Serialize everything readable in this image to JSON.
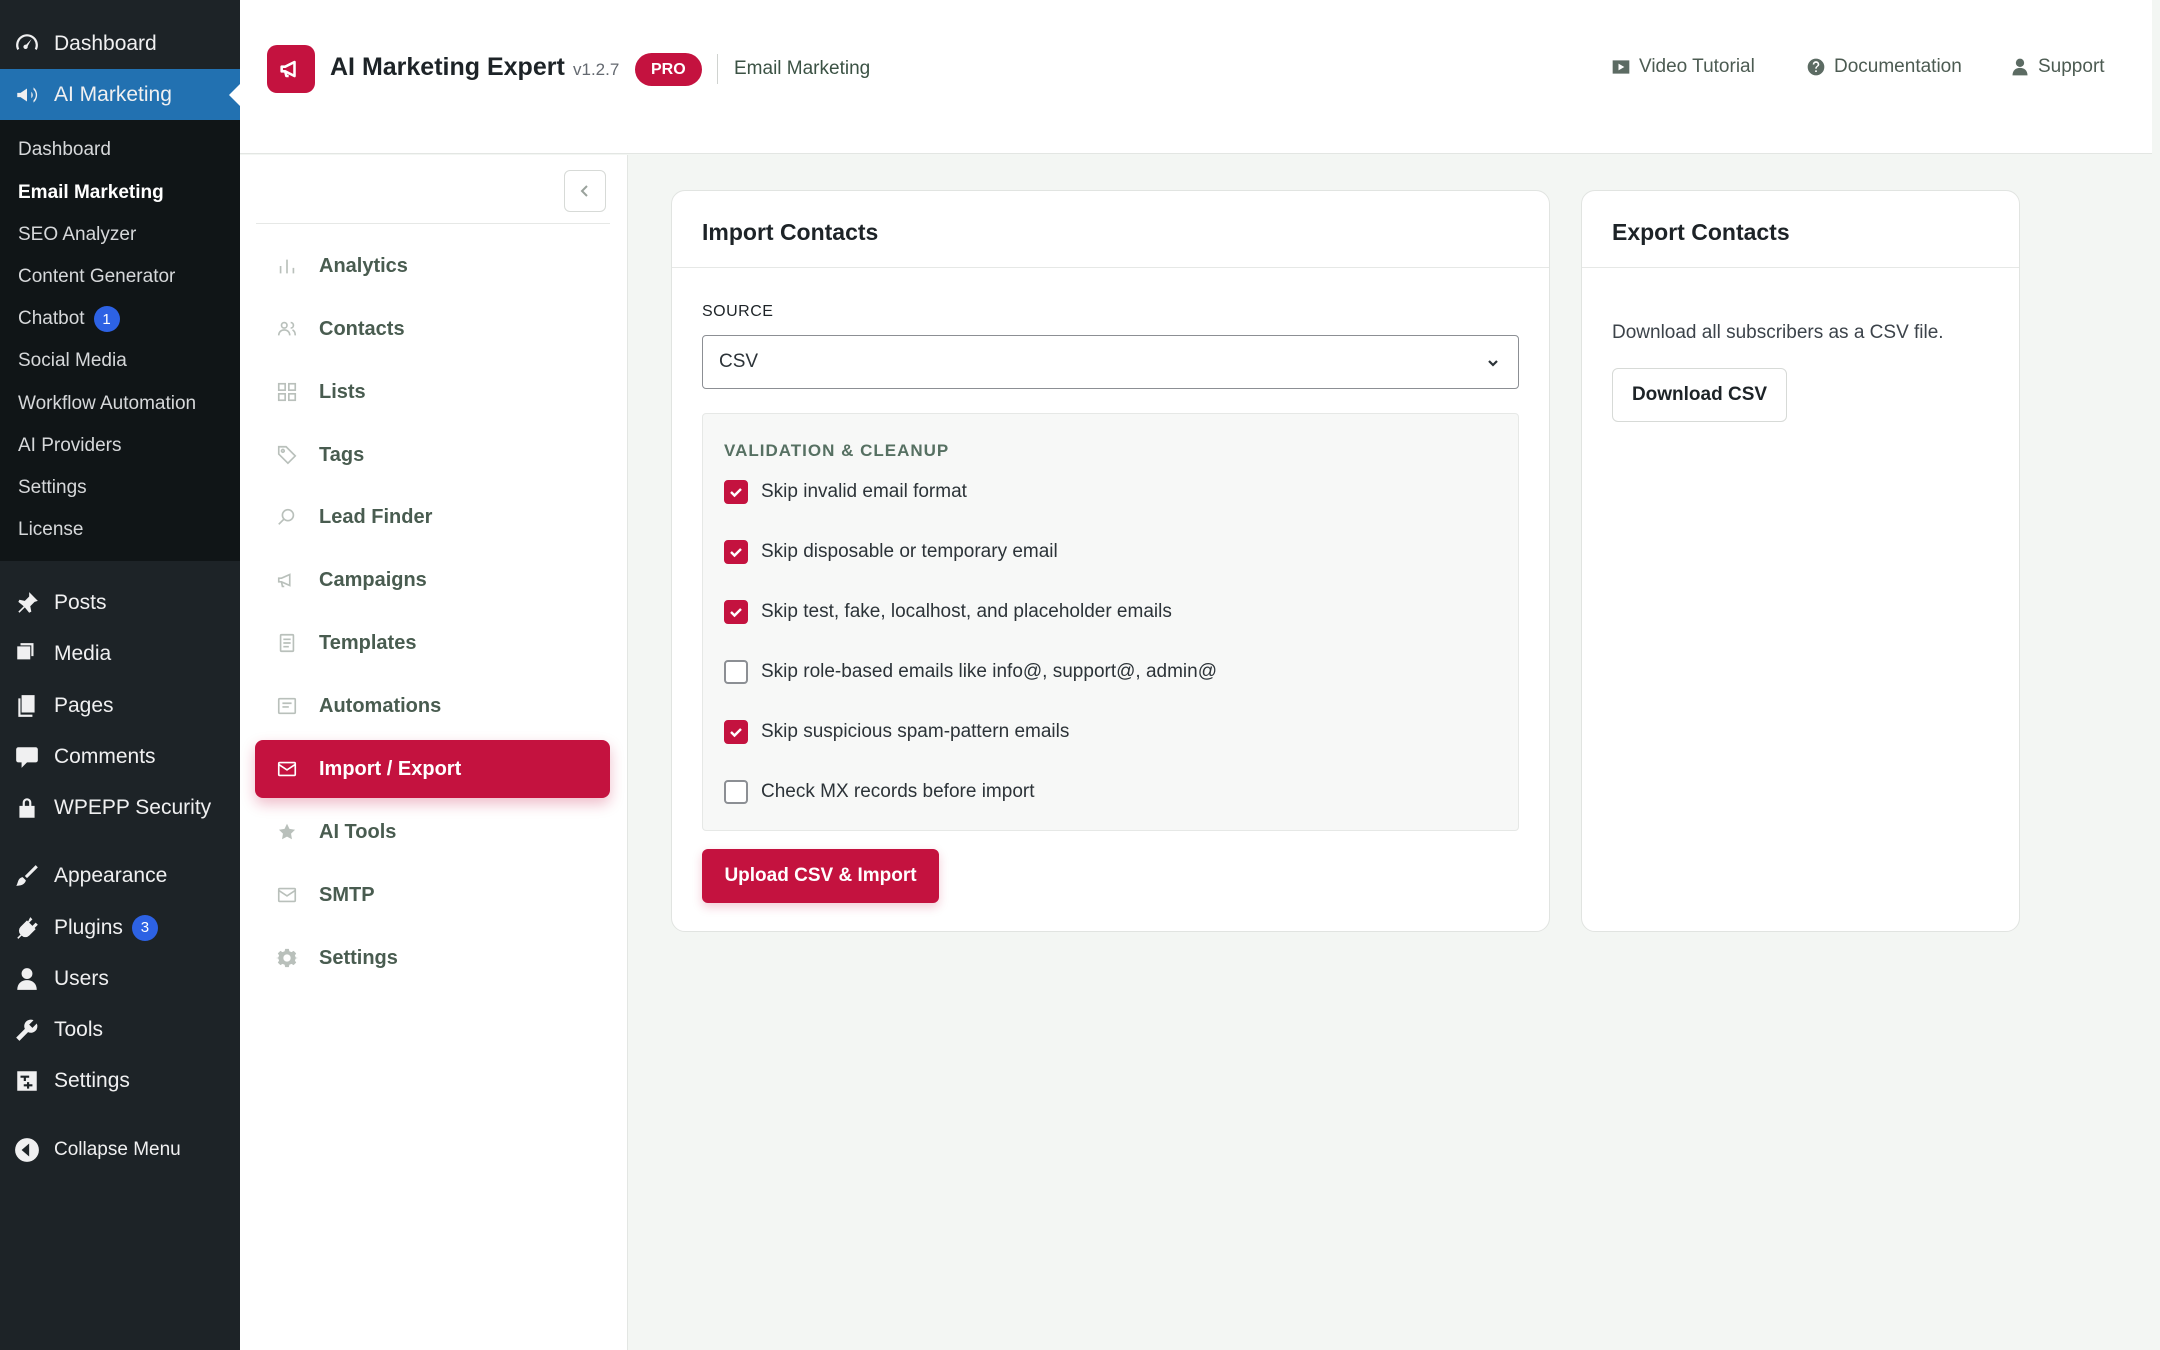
{
  "wp_menu": {
    "dashboard": "Dashboard",
    "ai_marketing": "AI Marketing",
    "submenu": [
      {
        "label": "Dashboard"
      },
      {
        "label": "Email Marketing"
      },
      {
        "label": "SEO Analyzer"
      },
      {
        "label": "Content Generator"
      },
      {
        "label": "Chatbot",
        "badge": "1"
      },
      {
        "label": "Social Media"
      },
      {
        "label": "Workflow Automation"
      },
      {
        "label": "AI Providers"
      },
      {
        "label": "Settings"
      },
      {
        "label": "License"
      }
    ],
    "posts": "Posts",
    "media": "Media",
    "pages": "Pages",
    "comments": "Comments",
    "security": "WPEPP Security",
    "appearance": "Appearance",
    "plugins": "Plugins",
    "plugins_badge": "3",
    "users": "Users",
    "tools": "Tools",
    "settings": "Settings",
    "collapse": "Collapse Menu"
  },
  "header": {
    "title": "AI Marketing Expert",
    "version": "v1.2.7",
    "pro_badge": "PRO",
    "section": "Email Marketing",
    "links": {
      "video": "Video Tutorial",
      "docs": "Documentation",
      "support": "Support"
    }
  },
  "nav": {
    "items": [
      {
        "label": "Analytics",
        "icon": "bar-chart-icon"
      },
      {
        "label": "Contacts",
        "icon": "users-icon"
      },
      {
        "label": "Lists",
        "icon": "grid-icon"
      },
      {
        "label": "Tags",
        "icon": "tag-icon"
      },
      {
        "label": "Lead Finder",
        "icon": "search-icon"
      },
      {
        "label": "Campaigns",
        "icon": "megaphone-icon"
      },
      {
        "label": "Templates",
        "icon": "document-icon"
      },
      {
        "label": "Automations",
        "icon": "list-icon"
      },
      {
        "label": "Import / Export",
        "icon": "envelope-icon",
        "active": true
      },
      {
        "label": "AI Tools",
        "icon": "star-icon"
      },
      {
        "label": "SMTP",
        "icon": "envelope-icon"
      },
      {
        "label": "Settings",
        "icon": "gear-icon"
      }
    ]
  },
  "import": {
    "title": "Import Contacts",
    "source_label": "SOURCE",
    "source_value": "CSV",
    "validation_title": "VALIDATION & CLEANUP",
    "options": [
      {
        "label": "Skip invalid email format",
        "checked": true
      },
      {
        "label": "Skip disposable or temporary email",
        "checked": true
      },
      {
        "label": "Skip test, fake, localhost, and placeholder emails",
        "checked": true
      },
      {
        "label": "Skip role-based emails like info@, support@, admin@",
        "checked": false
      },
      {
        "label": "Skip suspicious spam-pattern emails",
        "checked": true
      },
      {
        "label": "Check MX records before import",
        "checked": false
      }
    ],
    "upload_button": "Upload CSV & Import"
  },
  "export": {
    "title": "Export Contacts",
    "description": "Download all subscribers as a CSV file.",
    "download_button": "Download CSV"
  },
  "colors": {
    "accent": "#c4123f",
    "wp_sidebar": "#1d2327",
    "wp_active": "#2271b1"
  }
}
